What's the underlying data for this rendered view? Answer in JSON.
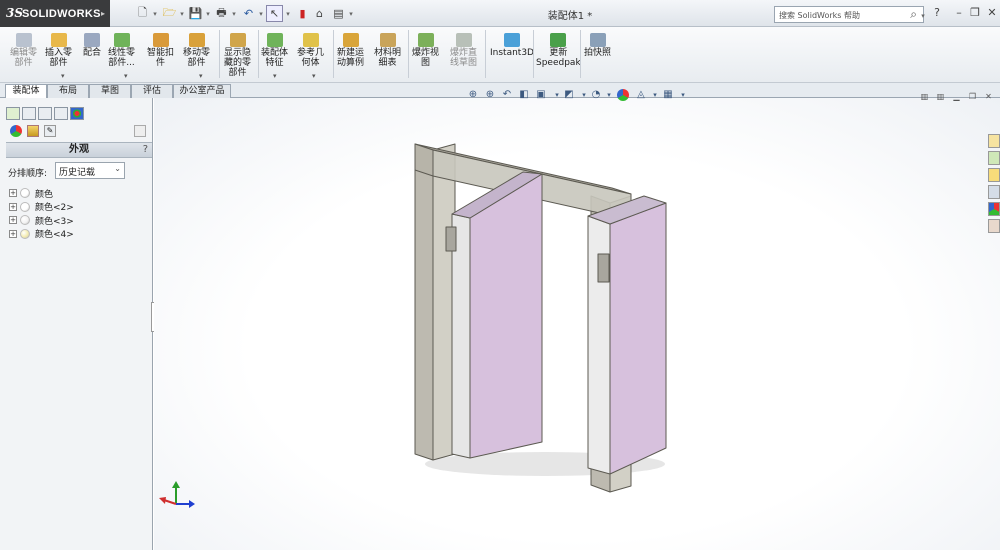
{
  "app": {
    "brand_ds": "3S",
    "brand_name": "SOLIDWORKS",
    "doc_title": "装配体1 *"
  },
  "search": {
    "placeholder": "搜索 SolidWorks 帮助"
  },
  "ribbon": {
    "buttons": [
      {
        "label": "编辑零\n部件",
        "icon": "edit-component-icon",
        "disabled": true
      },
      {
        "label": "插入零\n部件",
        "icon": "insert-component-icon"
      },
      {
        "label": "配合",
        "icon": "mate-icon"
      },
      {
        "label": "线性零\n部件...",
        "icon": "linear-pattern-icon"
      },
      {
        "label": "智能扣\n件",
        "icon": "smart-fastener-icon"
      },
      {
        "label": "移动零\n部件",
        "icon": "move-component-icon"
      },
      {
        "label": "显示隐\n藏的零\n部件",
        "icon": "show-hidden-icon"
      },
      {
        "label": "装配体\n特征",
        "icon": "assembly-feature-icon"
      },
      {
        "label": "参考几\n何体",
        "icon": "reference-geometry-icon"
      },
      {
        "label": "新建运\n动算例",
        "icon": "motion-study-icon"
      },
      {
        "label": "材料明\n细表",
        "icon": "bom-icon"
      },
      {
        "label": "爆炸视\n图",
        "icon": "exploded-view-icon"
      },
      {
        "label": "爆炸直\n线草图",
        "icon": "explode-line-sketch-icon",
        "disabled": true
      },
      {
        "label": "Instant3D",
        "icon": "instant3d-icon"
      },
      {
        "label": "更新\nSpeedpak",
        "icon": "speedpak-icon"
      },
      {
        "label": "拍快照",
        "icon": "snapshot-icon"
      }
    ]
  },
  "tabs": [
    {
      "label": "装配体",
      "active": true
    },
    {
      "label": "布局"
    },
    {
      "label": "草图"
    },
    {
      "label": "评估"
    },
    {
      "label": "办公室产品"
    }
  ],
  "panel": {
    "title": "外观",
    "help": "?",
    "sort_label": "分排顺序:",
    "sort_value": "历史记载",
    "tree": [
      {
        "label": "颜色",
        "color": "#ffffff"
      },
      {
        "label": "颜色<2>",
        "color": "#ffffff"
      },
      {
        "label": "颜色<3>",
        "color": "#f3f3f3"
      },
      {
        "label": "颜色<4>",
        "color": "#f4ecb0"
      }
    ]
  },
  "colors": {
    "frame": "#b8b5a8",
    "door": "#d7c1dd",
    "accent": "#cf2e2e"
  }
}
